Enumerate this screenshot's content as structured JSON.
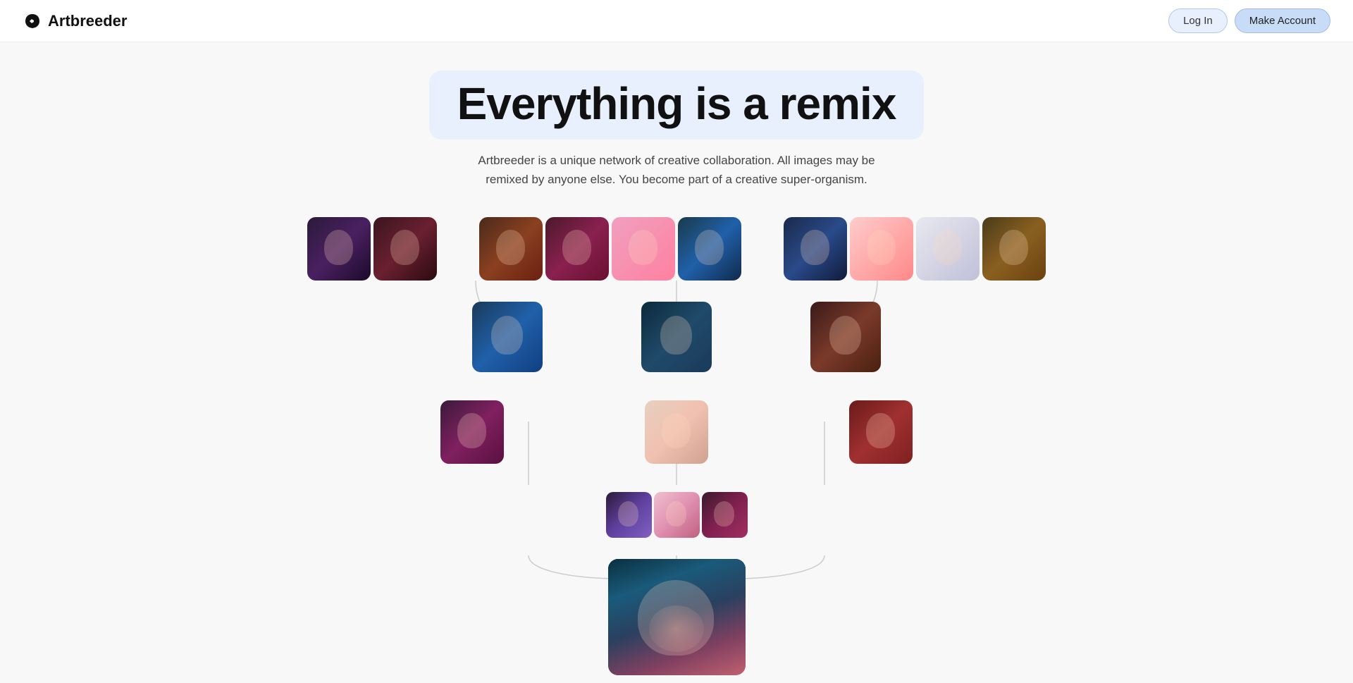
{
  "navbar": {
    "logo_text": "Artbreeder",
    "login_label": "Log In",
    "make_account_label": "Make Account"
  },
  "hero": {
    "title": "Everything is a remix",
    "subtitle": "Artbreeder is a unique network of creative collaboration. All images may be remixed by anyone else. You become part of a creative super-organism."
  },
  "tree": {
    "description": "Generative art tree showing image lineage"
  }
}
